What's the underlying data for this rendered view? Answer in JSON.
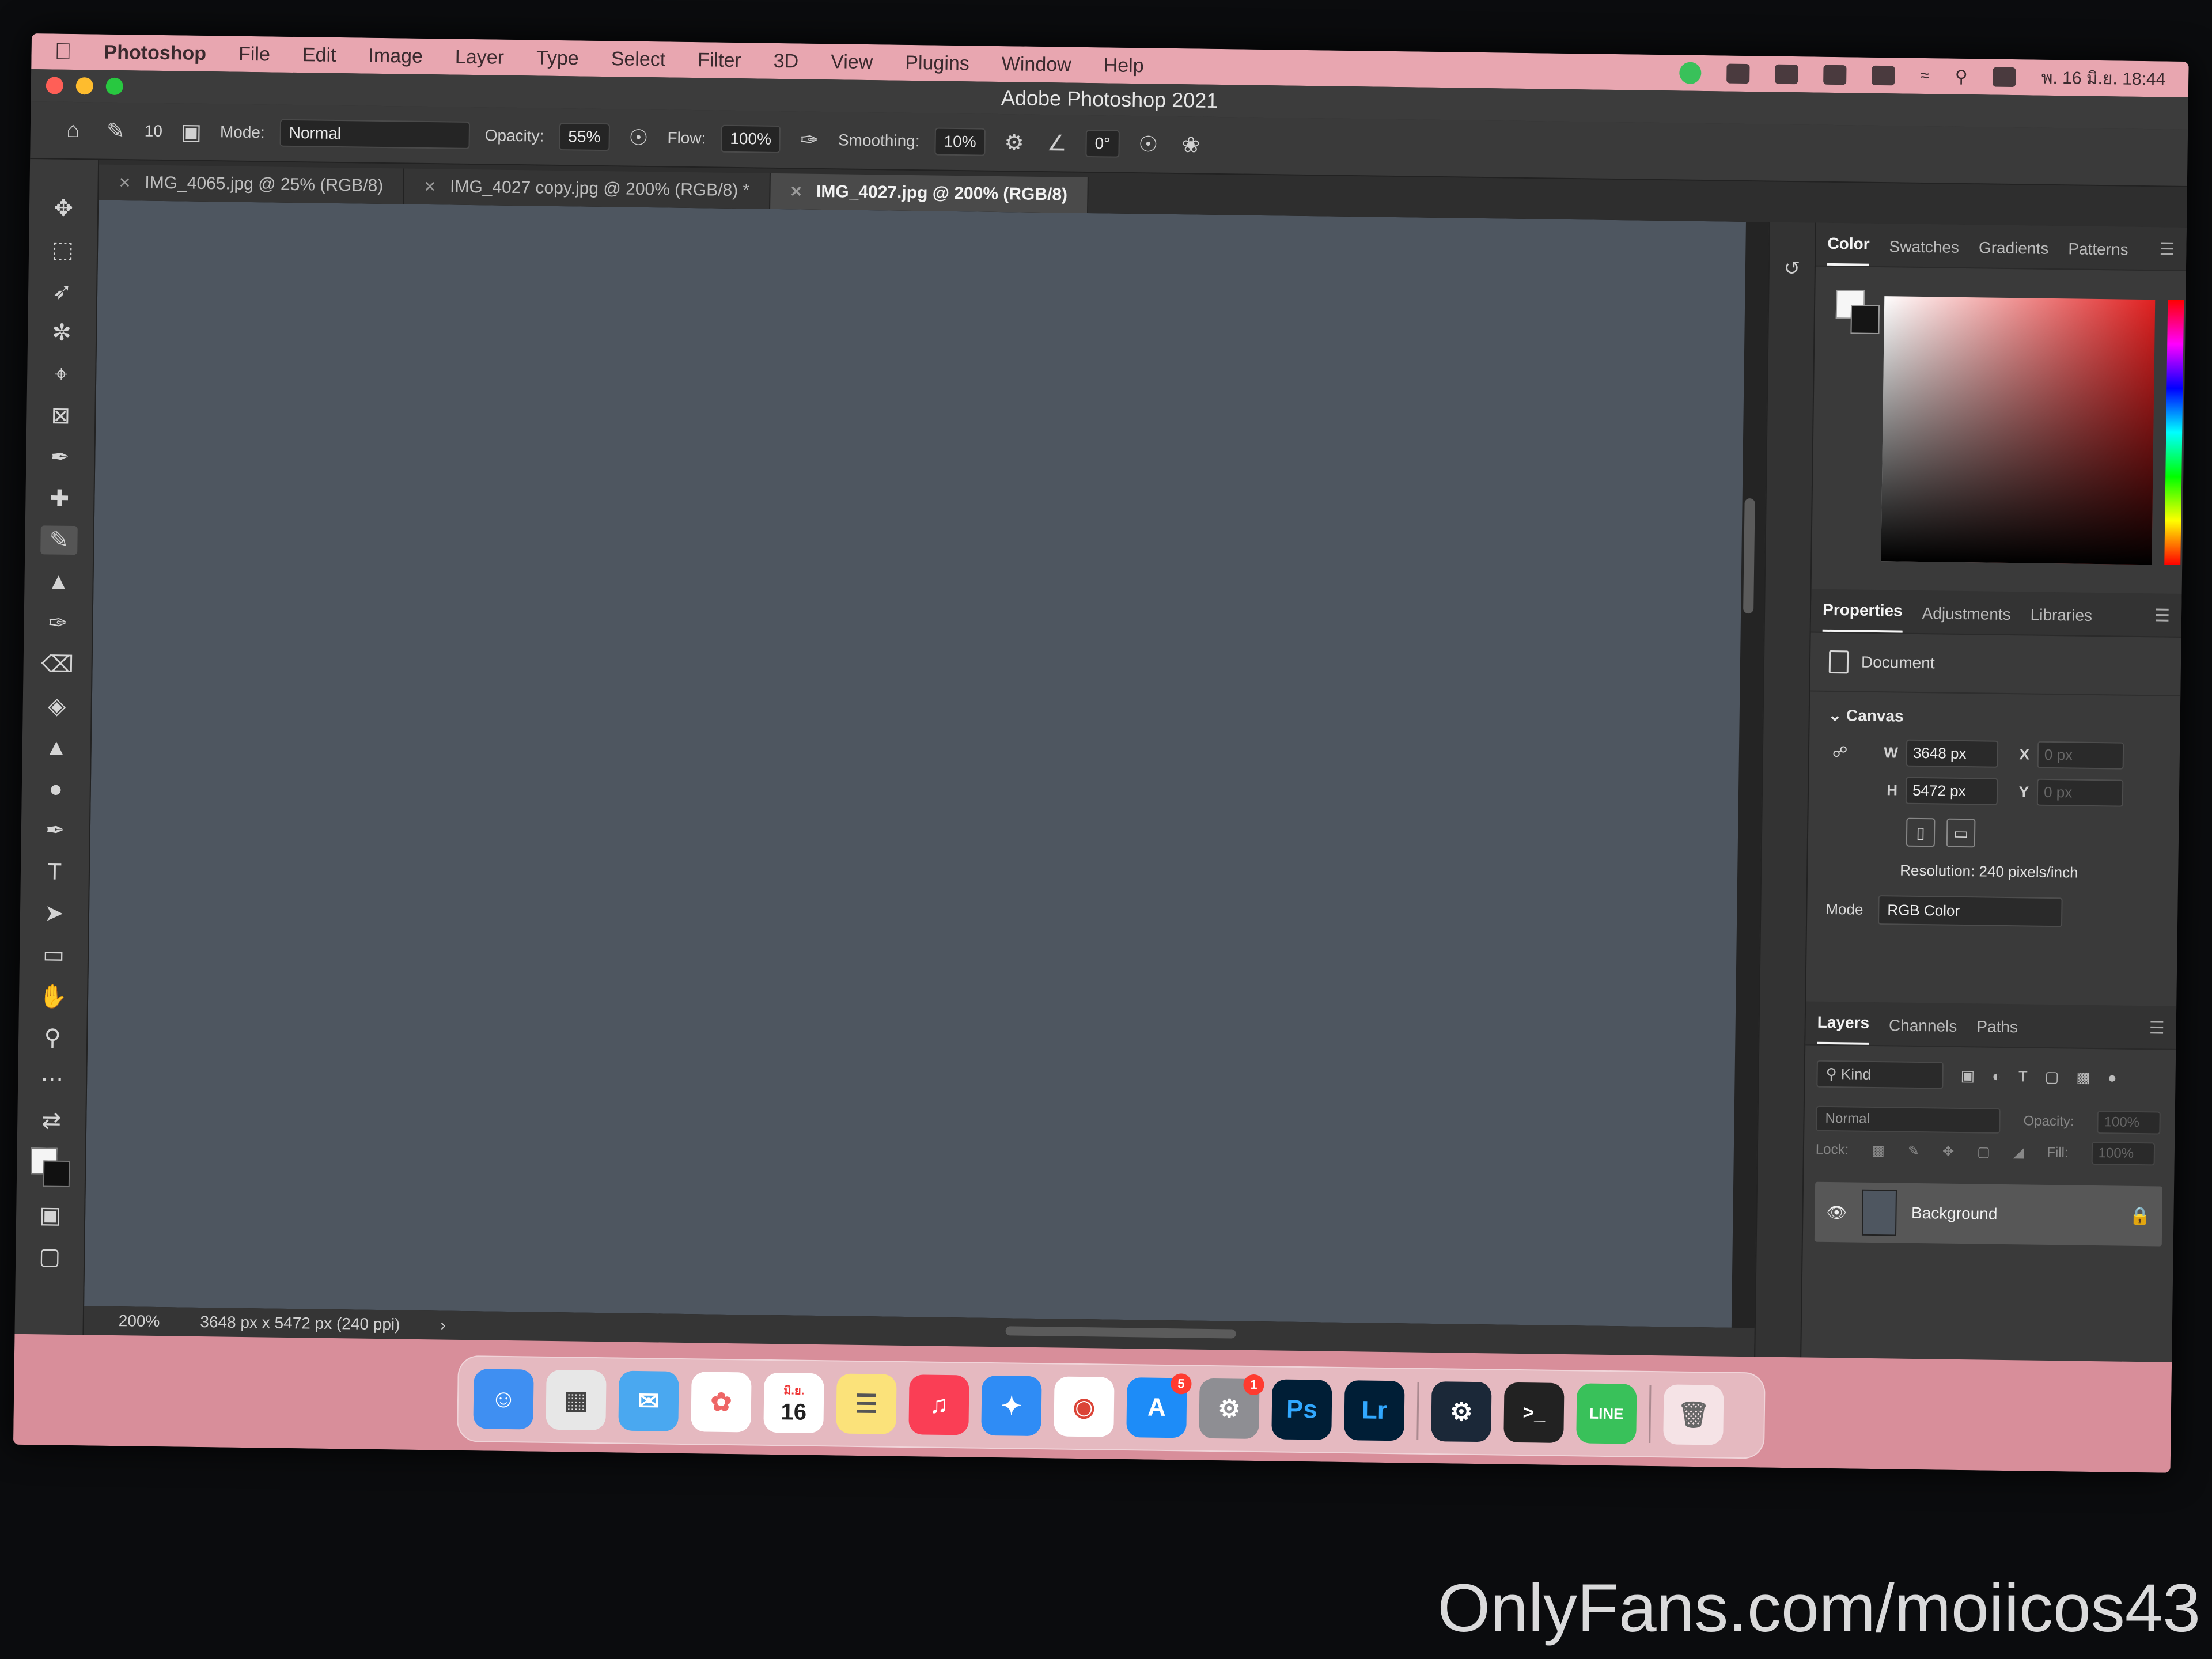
{
  "menubar": {
    "app_name": "Photoshop",
    "items": [
      "File",
      "Edit",
      "Image",
      "Layer",
      "Type",
      "Select",
      "Filter",
      "3D",
      "View",
      "Plugins",
      "Window",
      "Help"
    ],
    "datetime": "พ. 16 มิ.ย.  18:44"
  },
  "window": {
    "title": "Adobe Photoshop 2021"
  },
  "options": {
    "brush_size": "10",
    "mode_label": "Mode:",
    "mode_value": "Normal",
    "opacity_label": "Opacity:",
    "opacity_value": "55%",
    "flow_label": "Flow:",
    "flow_value": "100%",
    "smoothing_label": "Smoothing:",
    "smoothing_value": "10%",
    "angle_value": "0°"
  },
  "tabs": [
    {
      "label": "IMG_4065.jpg @ 25% (RGB/8)"
    },
    {
      "label": "IMG_4027 copy.jpg @ 200% (RGB/8) *"
    },
    {
      "label": "IMG_4027.jpg @ 200% (RGB/8)"
    }
  ],
  "canvas": {
    "placeholder": ""
  },
  "status": {
    "zoom": "200%",
    "doc_info": "3648 px x 5472 px (240 ppi)"
  },
  "color_panel": {
    "tabs": [
      "Color",
      "Swatches",
      "Gradients",
      "Patterns"
    ]
  },
  "properties_panel": {
    "tabs": [
      "Properties",
      "Adjustments",
      "Libraries"
    ],
    "document_label": "Document",
    "canvas_label": "Canvas",
    "w_label": "W",
    "w_value": "3648 px",
    "h_label": "H",
    "h_value": "5472 px",
    "x_label": "X",
    "x_value": "0 px",
    "y_label": "Y",
    "y_value": "0 px",
    "resolution": "Resolution: 240 pixels/inch",
    "mode_label": "Mode",
    "mode_value": "RGB Color"
  },
  "layers_panel": {
    "tabs": [
      "Layers",
      "Channels",
      "Paths"
    ],
    "kind_label": "Kind",
    "blend_mode": "Normal",
    "opacity_label": "Opacity:",
    "opacity_value": "100%",
    "lock_label": "Lock:",
    "fill_label": "Fill:",
    "fill_value": "100%",
    "layer_name": "Background"
  },
  "dock": {
    "calendar_month": "มิ.ย.",
    "calendar_day": "16",
    "appstore_badge": "5",
    "settings_badge": "1",
    "ps_label": "Ps",
    "lr_label": "Lr"
  },
  "watermark": "OnlyFans.com/moiicos43",
  "colors": {
    "menubar": "#e8a6b0",
    "accent_line": "#39c15a",
    "ps_blue": "#31a8ff"
  }
}
